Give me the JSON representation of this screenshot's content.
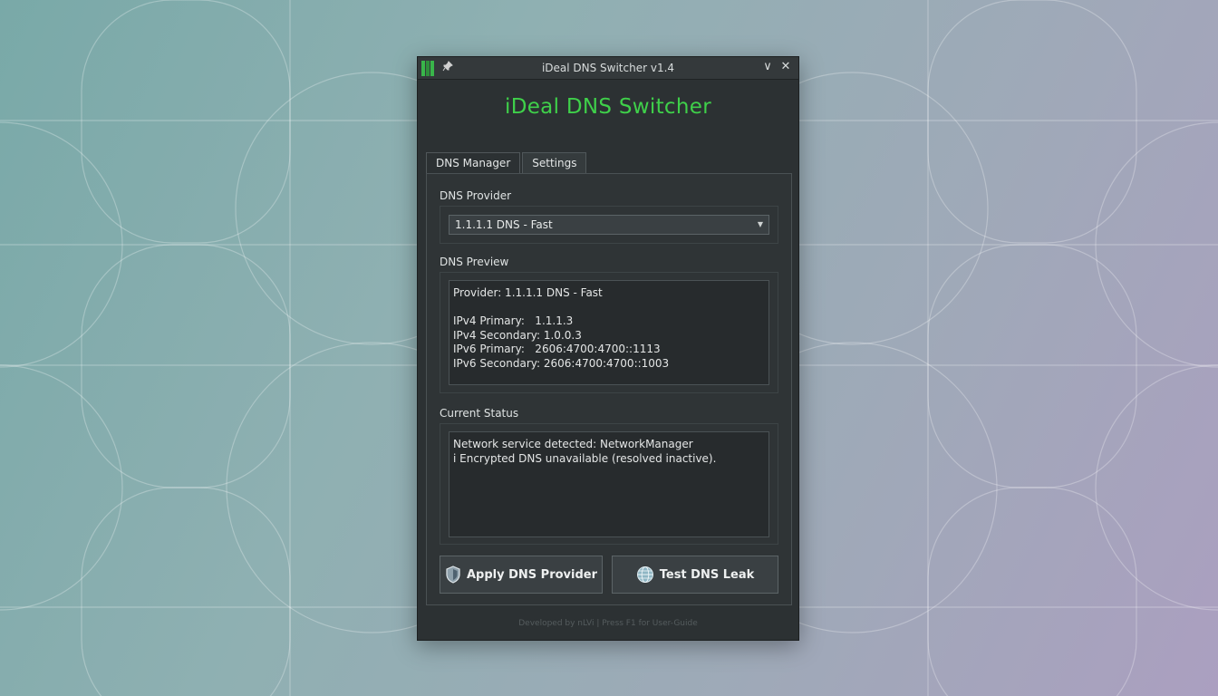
{
  "window": {
    "title": "iDeal DNS Switcher v1.4",
    "heading": "iDeal DNS Switcher",
    "minimize_glyph": "∨",
    "close_glyph": "✕"
  },
  "tabs": [
    {
      "label": "DNS Manager",
      "active": true
    },
    {
      "label": "Settings",
      "active": false
    }
  ],
  "dns_provider": {
    "label": "DNS Provider",
    "selected": "1.1.1.1 DNS - Fast"
  },
  "dns_preview": {
    "label": "DNS Preview",
    "lines": [
      "Provider: 1.1.1.1 DNS - Fast",
      "",
      "IPv4 Primary:   1.1.1.3",
      "IPv4 Secondary: 1.0.0.3",
      "IPv6 Primary:   2606:4700:4700::1113",
      "IPv6 Secondary: 2606:4700:4700::1003"
    ]
  },
  "current_status": {
    "label": "Current Status",
    "lines": [
      "Network service detected: NetworkManager",
      "i Encrypted DNS unavailable (resolved inactive)."
    ]
  },
  "buttons": {
    "apply": "Apply DNS Provider",
    "test": "Test DNS Leak"
  },
  "footer": "Developed by nLVi | Press F1 for User-Guide",
  "colors": {
    "accent_green": "#3fd04a",
    "window_bg": "#2c3133"
  }
}
